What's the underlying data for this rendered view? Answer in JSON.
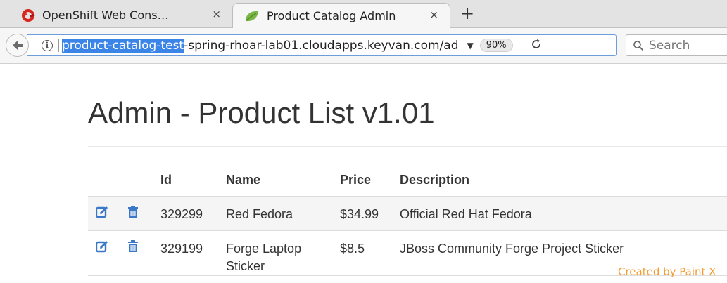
{
  "browser": {
    "tabs": [
      {
        "title": "OpenShift Web Cons…",
        "close": "×"
      },
      {
        "title": "Product Catalog Admin",
        "close": "×"
      }
    ],
    "new_tab": "+",
    "url_selected": "product-catalog-test",
    "url_rest": "-spring-rhoar-lab01.cloudapps.keyvan.com/ad",
    "zoom": "90%",
    "search_placeholder": "Search",
    "icons": [
      "openshift-logo",
      "spring-leaf",
      "back-arrow",
      "info",
      "dropdown-arrow",
      "reload",
      "search"
    ],
    "colors": {
      "selection": "#3b84e8",
      "url_focus_border": "#6e9ddb"
    }
  },
  "page": {
    "title": "Admin - Product List v1.01",
    "columns": {
      "id": "Id",
      "name": "Name",
      "price": "Price",
      "description": "Description"
    },
    "rows": [
      {
        "id": "329299",
        "name": "Red Fedora",
        "price": "$34.99",
        "description": "Official Red Hat Fedora"
      },
      {
        "id": "329199",
        "name": "Forge Laptop Sticker",
        "price": "$8.5",
        "description": "JBoss Community Forge Project Sticker"
      }
    ],
    "row_icons": [
      "edit-icon",
      "trash-icon"
    ],
    "colors": {
      "icon_blue": "#3c78c8"
    }
  },
  "watermark": "Created by Paint X"
}
